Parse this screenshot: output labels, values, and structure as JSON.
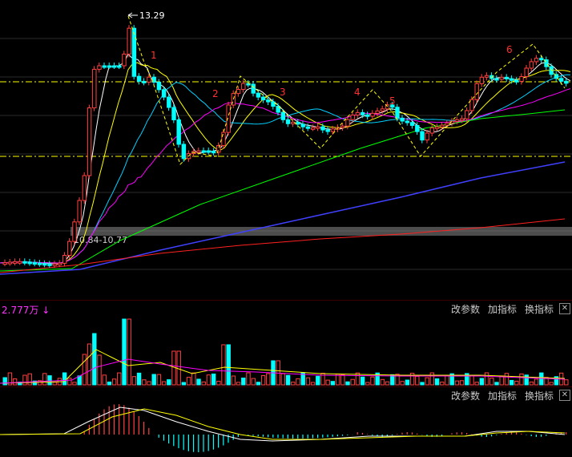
{
  "main": {
    "peak_label": "13.29",
    "band_label": "10.84-10.77",
    "wave_labels": [
      "1",
      "2",
      "3",
      "4",
      "5",
      "6"
    ]
  },
  "volume": {
    "value_label": "2.777万",
    "arrow": "↓",
    "buttons": [
      "改参数",
      "加指标",
      "换指标"
    ],
    "close": "✕"
  },
  "macd": {
    "buttons": [
      "改参数",
      "加指标",
      "换指标"
    ],
    "close": "✕"
  },
  "colors": {
    "up": "#ff4040",
    "down": "#00ffff",
    "ma5": "#ffffff",
    "ma10": "#ffff00",
    "ma20": "#ff00ff",
    "ma30": "#00ff00",
    "ma60": "#4040ff",
    "ma120": "#ff2020",
    "wave": "#ffff00"
  }
}
